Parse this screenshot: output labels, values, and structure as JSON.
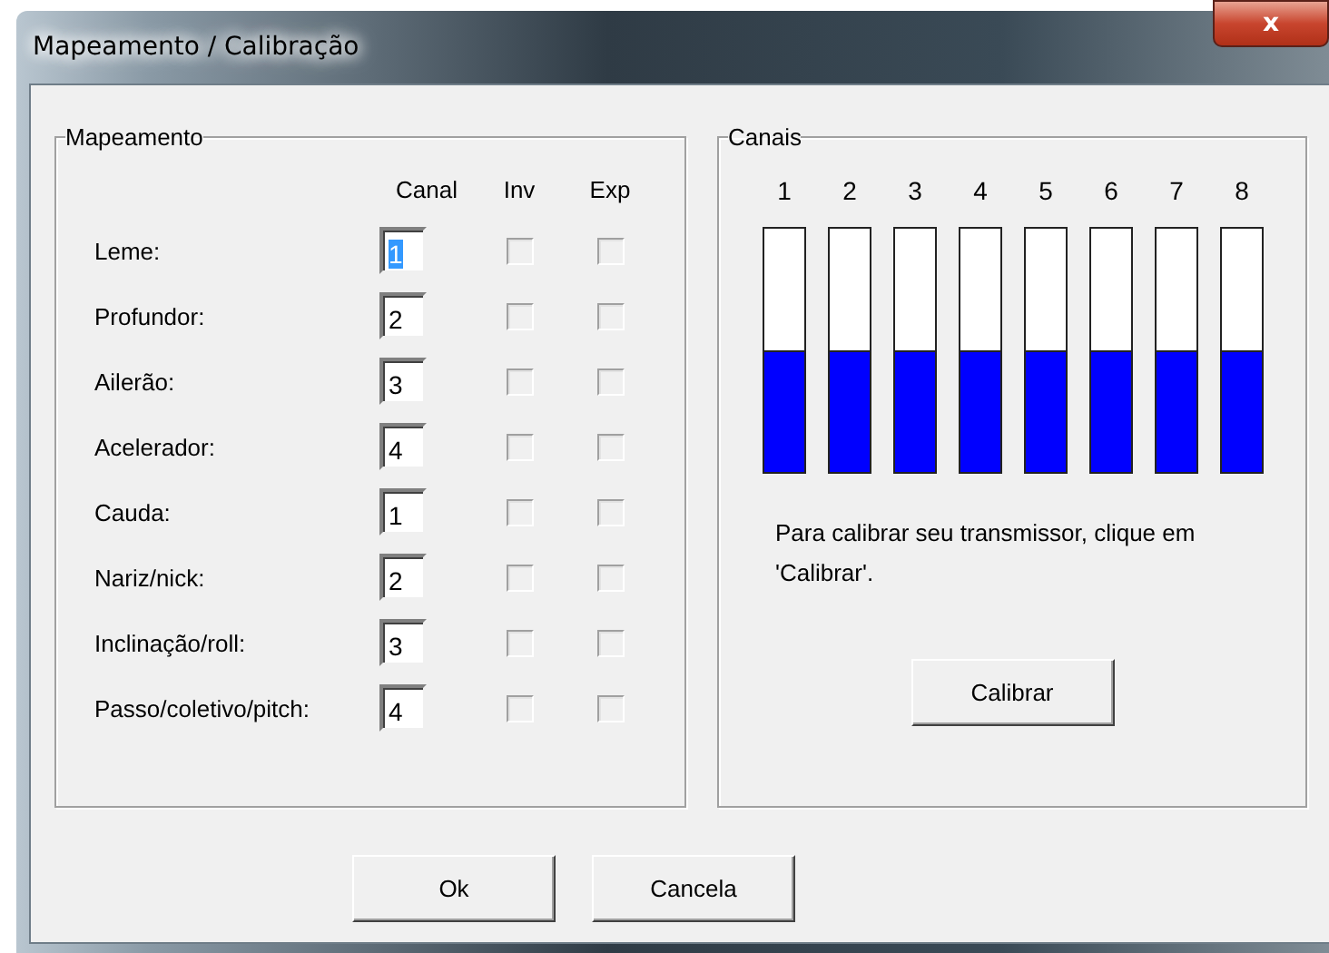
{
  "window": {
    "title": "Mapeamento / Calibração",
    "close": "x"
  },
  "mapping": {
    "title": "Mapeamento",
    "columns": [
      "Canal",
      "Inv",
      "Exp"
    ],
    "rows": [
      {
        "label": "Leme:",
        "channel": "1",
        "text_selected": true,
        "inv": false,
        "exp": false
      },
      {
        "label": "Profundor:",
        "channel": "2",
        "text_selected": false,
        "inv": false,
        "exp": false
      },
      {
        "label": "Ailerão:",
        "channel": "3",
        "text_selected": false,
        "inv": false,
        "exp": false
      },
      {
        "label": "Acelerador:",
        "channel": "4",
        "text_selected": false,
        "inv": false,
        "exp": false
      },
      {
        "label": "Cauda:",
        "channel": "1",
        "text_selected": false,
        "inv": false,
        "exp": false
      },
      {
        "label": "Nariz/nick:",
        "channel": "2",
        "text_selected": false,
        "inv": false,
        "exp": false
      },
      {
        "label": "Inclinação/roll:",
        "channel": "3",
        "text_selected": false,
        "inv": false,
        "exp": false
      },
      {
        "label": "Passo/coletivo/pitch:",
        "channel": "4",
        "text_selected": false,
        "inv": false,
        "exp": false
      }
    ]
  },
  "channels": {
    "title": "Canais",
    "bars": [
      {
        "label": "1",
        "level": 0.5
      },
      {
        "label": "2",
        "level": 0.5
      },
      {
        "label": "3",
        "level": 0.5
      },
      {
        "label": "4",
        "level": 0.5
      },
      {
        "label": "5",
        "level": 0.5
      },
      {
        "label": "6",
        "level": 0.5
      },
      {
        "label": "7",
        "level": 0.5
      },
      {
        "label": "8",
        "level": 0.5
      }
    ],
    "hint": "Para calibrar seu transmissor, clique em 'Calibrar'.",
    "button": "Calibrar"
  },
  "buttons": [
    "Ok",
    "Cancela"
  ]
}
